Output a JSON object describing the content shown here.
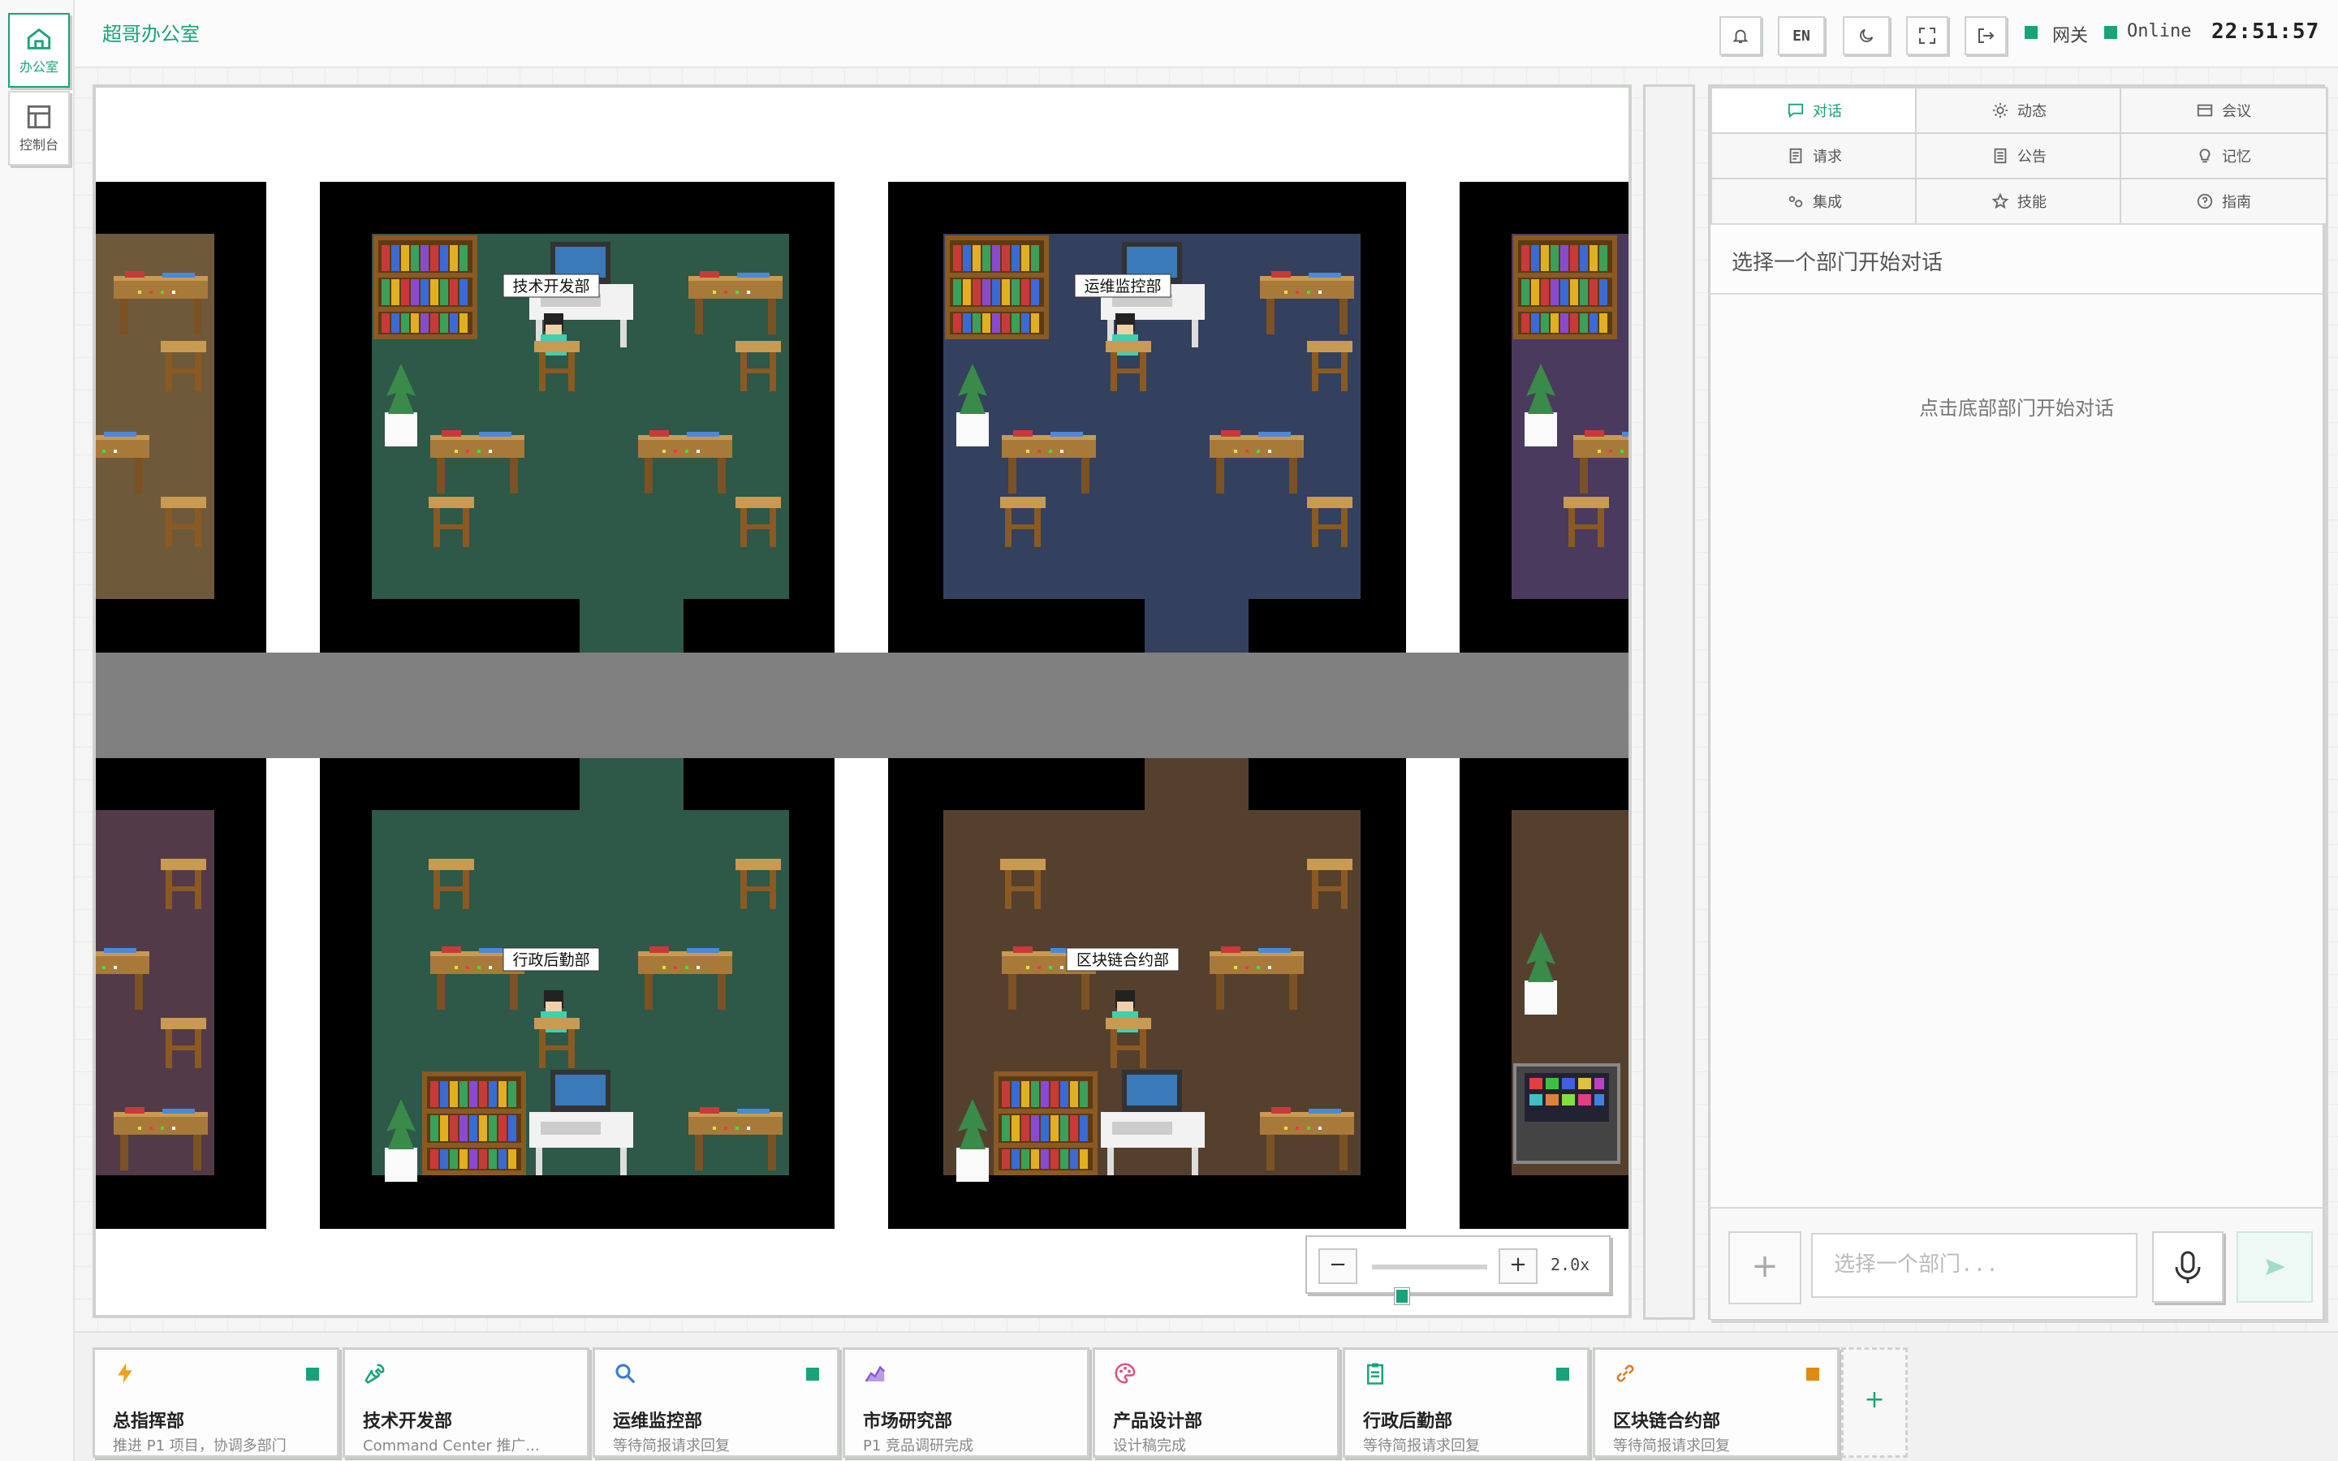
{
  "rail": {
    "items": [
      {
        "label": "办公室",
        "icon": "home-icon",
        "active": true
      },
      {
        "label": "控制台",
        "icon": "dashboard-icon",
        "active": false
      }
    ]
  },
  "header": {
    "title": "超哥办公室",
    "lang_label": "EN",
    "gateway_label": "网关",
    "online_label": "Online",
    "clock": "22:51:57",
    "status_color": "#18a37a"
  },
  "office": {
    "room_labels": [
      "技术开发部",
      "运维监控部",
      "行政后勤部",
      "区块链合约部"
    ],
    "zoom_label": "2.0x",
    "zoom_minus": "−",
    "zoom_plus": "+",
    "zoom_level": 0.2
  },
  "panel": {
    "tabs": [
      {
        "label": "对话",
        "icon": "chat-icon",
        "active": true
      },
      {
        "label": "动态",
        "icon": "sun-icon"
      },
      {
        "label": "会议",
        "icon": "meeting-icon"
      },
      {
        "label": "请求",
        "icon": "document-icon"
      },
      {
        "label": "公告",
        "icon": "notice-icon"
      },
      {
        "label": "记忆",
        "icon": "bulb-icon"
      },
      {
        "label": "集成",
        "icon": "integration-icon"
      },
      {
        "label": "技能",
        "icon": "star-icon"
      },
      {
        "label": "指南",
        "icon": "help-icon"
      }
    ],
    "select_prompt": "选择一个部门开始对话",
    "empty_hint": "点击底部部门开始对话",
    "input_placeholder": "选择一个部门...",
    "add_symbol": "+"
  },
  "departments": [
    {
      "name": "总指挥部",
      "status": "推进 P1 项目，协调多部门",
      "icon": "bolt-icon",
      "icon_color": "#f0a020",
      "dot": "#18a37a"
    },
    {
      "name": "技术开发部",
      "status": "Command Center 推广...",
      "icon": "wrench-icon",
      "icon_color": "#18a37a",
      "dot": null
    },
    {
      "name": "运维监控部",
      "status": "等待简报请求回复",
      "icon": "search-icon",
      "icon_color": "#3a7bd5",
      "dot": "#18a37a"
    },
    {
      "name": "市场研究部",
      "status": "P1 竞品调研完成",
      "icon": "chart-icon",
      "icon_color": "#8a5cd6",
      "dot": null
    },
    {
      "name": "产品设计部",
      "status": "设计稿完成",
      "icon": "palette-icon",
      "icon_color": "#e0507a",
      "dot": null
    },
    {
      "name": "行政后勤部",
      "status": "等待简报请求回复",
      "icon": "clipboard-icon",
      "icon_color": "#18a37a",
      "dot": "#18a37a"
    },
    {
      "name": "区块链合约部",
      "status": "等待简报请求回复",
      "icon": "link-icon",
      "icon_color": "#e07a20",
      "dot": "#e08a10"
    }
  ],
  "add_department": "+"
}
